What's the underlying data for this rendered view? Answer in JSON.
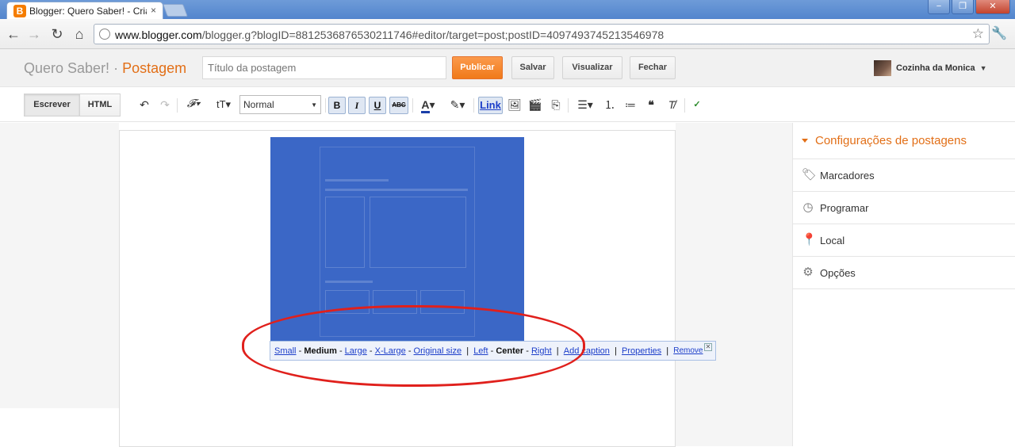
{
  "browser": {
    "tab_title": "Blogger: Quero Saber! - Criar",
    "tab_close": "×",
    "url_host": "www.blogger.com",
    "url_path": "/blogger.g?blogID=8812536876530211746#editor/target=post;postID=4097493745213546978",
    "win_min": "−",
    "win_max": "❐",
    "win_close": "✕"
  },
  "header": {
    "blog_name": "Quero Saber!",
    "separator": "·",
    "page": "Postagem",
    "title_placeholder": "Título da postagem",
    "publish": "Publicar",
    "save": "Salvar",
    "preview": "Visualizar",
    "close": "Fechar",
    "user": "Cozinha da Monica"
  },
  "editor_toolbar": {
    "compose": "Escrever",
    "html": "HTML",
    "font_size": "Normal",
    "bold": "B",
    "italic": "I",
    "underline": "U",
    "strike": "ABC",
    "link": "Link"
  },
  "image_bubble": {
    "small": "Small",
    "medium": "Medium",
    "large": "Large",
    "xlarge": "X-Large",
    "original": "Original size",
    "left": "Left",
    "center": "Center",
    "right": "Right",
    "caption": "Add caption",
    "properties": "Properties",
    "remove": "Remove",
    "dash": "-",
    "bar": "|"
  },
  "sidebar": {
    "heading": "Configurações de postagens",
    "items": [
      {
        "label": "Marcadores",
        "icon": "tag-icon"
      },
      {
        "label": "Programar",
        "icon": "clock-icon"
      },
      {
        "label": "Local",
        "icon": "location-pin-icon"
      },
      {
        "label": "Opções",
        "icon": "gear-icon"
      }
    ]
  },
  "colors": {
    "accent": "#e26f17",
    "publish": "#f07a1a",
    "selection": "#3b67c6",
    "annotation": "#e0201c",
    "link": "#1c3ec9"
  }
}
